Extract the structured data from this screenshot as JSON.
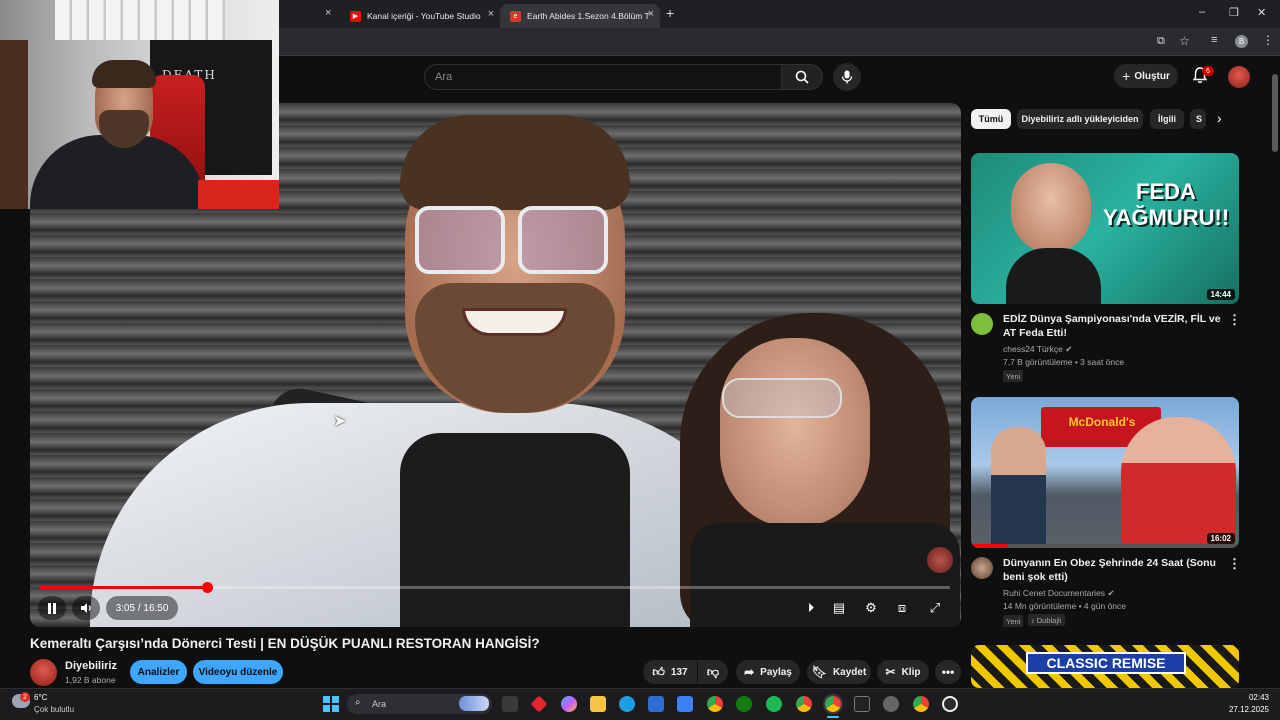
{
  "browser": {
    "tabs": [
      {
        "label": "Kanal içeriği - YouTube Studio"
      },
      {
        "label": "Earth Abides 1.Sezon 4.Bölüm T"
      }
    ],
    "close_glyph": "×",
    "new_tab_glyph": "+"
  },
  "youtube": {
    "search_placeholder": "Ara",
    "create_label": "Oluştur",
    "notifications_count": "6"
  },
  "player": {
    "time": "3:05 / 16:50",
    "progress_fraction": 0.183
  },
  "video": {
    "title": "Kemeraltı Çarşısı’nda Dönerci Testi | EN DÜŞÜK PUANLI RESTORAN HANGİSİ?",
    "channel": "Diyebiliriz",
    "subscribers": "1,92 B abone",
    "analytics_label": "Analizler",
    "edit_label": "Videoyu düzenle",
    "likes": "137",
    "share_label": "Paylaş",
    "save_label": "Kaydet",
    "clip_label": "Klip"
  },
  "chips": [
    "Tümü",
    "Diyebiliriz adlı yükleyiciden",
    "İlgili",
    "S"
  ],
  "recommendations": [
    {
      "thumb_text": "FEDA YAĞMURU!!",
      "duration": "14:44",
      "title": "EDİZ Dünya Şampiyonası'nda VEZİR, FİL ve AT Feda Etti!",
      "channel": "chess24 Türkçe",
      "meta": "7,7 B görüntüleme • 3 saat önce",
      "badges": [
        "Yeni"
      ]
    },
    {
      "thumb_text": "McDonald's",
      "duration": "16:02",
      "title": "Dünyanın En Obez Şehrinde 24 Saat (Sonu beni şok etti)",
      "channel": "Ruhi Cenet Documentaries",
      "meta": "14 Mn görüntüleme • 4 gün önce",
      "badges": [
        "Yeni",
        "Dublajlı"
      ]
    },
    {
      "thumb_text": "CLASSIC REMISE"
    }
  ],
  "taskbar": {
    "weather_temp": "6°C",
    "weather_desc": "Çok bulutlu",
    "weather_badge": "2",
    "search_placeholder": "Ara",
    "time": "02:43",
    "date": "27.12.2025"
  },
  "webcam": {
    "flag_text": "DEATH"
  },
  "colors": {
    "accent_red": "#ff0000",
    "blue_button": "#3ea6ff",
    "background": "#0f0f0f"
  }
}
